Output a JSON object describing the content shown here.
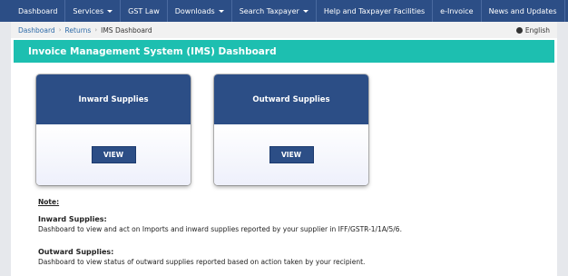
{
  "nav": {
    "items": [
      {
        "label": "Dashboard",
        "caret": false
      },
      {
        "label": "Services",
        "caret": true
      },
      {
        "label": "GST Law",
        "caret": false
      },
      {
        "label": "Downloads",
        "caret": true
      },
      {
        "label": "Search Taxpayer",
        "caret": true
      },
      {
        "label": "Help and Taxpayer Facilities",
        "caret": false
      },
      {
        "label": "e-Invoice",
        "caret": false
      },
      {
        "label": "News and Updates",
        "caret": false
      }
    ]
  },
  "breadcrumb": {
    "items": [
      "Dashboard",
      "Returns",
      "IMS Dashboard"
    ],
    "language": "English",
    "language_icon": "globe-icon"
  },
  "page": {
    "title": "Invoice Management System (IMS) Dashboard"
  },
  "cards": [
    {
      "title": "Inward Supplies",
      "button": "VIEW"
    },
    {
      "title": "Outward Supplies",
      "button": "VIEW"
    }
  ],
  "notes": {
    "heading": "Note:",
    "inward_title": "Inward Supplies:",
    "inward_text": "Dashboard to view and act on Imports and inward supplies reported by your supplier in IFF/GSTR-1/1A/5/6.",
    "outward_title": "Outward Supplies:",
    "outward_text": "Dashboard to view status of outward supplies reported based on action taken by your recipient."
  },
  "colors": {
    "nav_bg": "#2c4e86",
    "title_bar": "#1dbfb0",
    "card_header": "#2c4e86"
  }
}
